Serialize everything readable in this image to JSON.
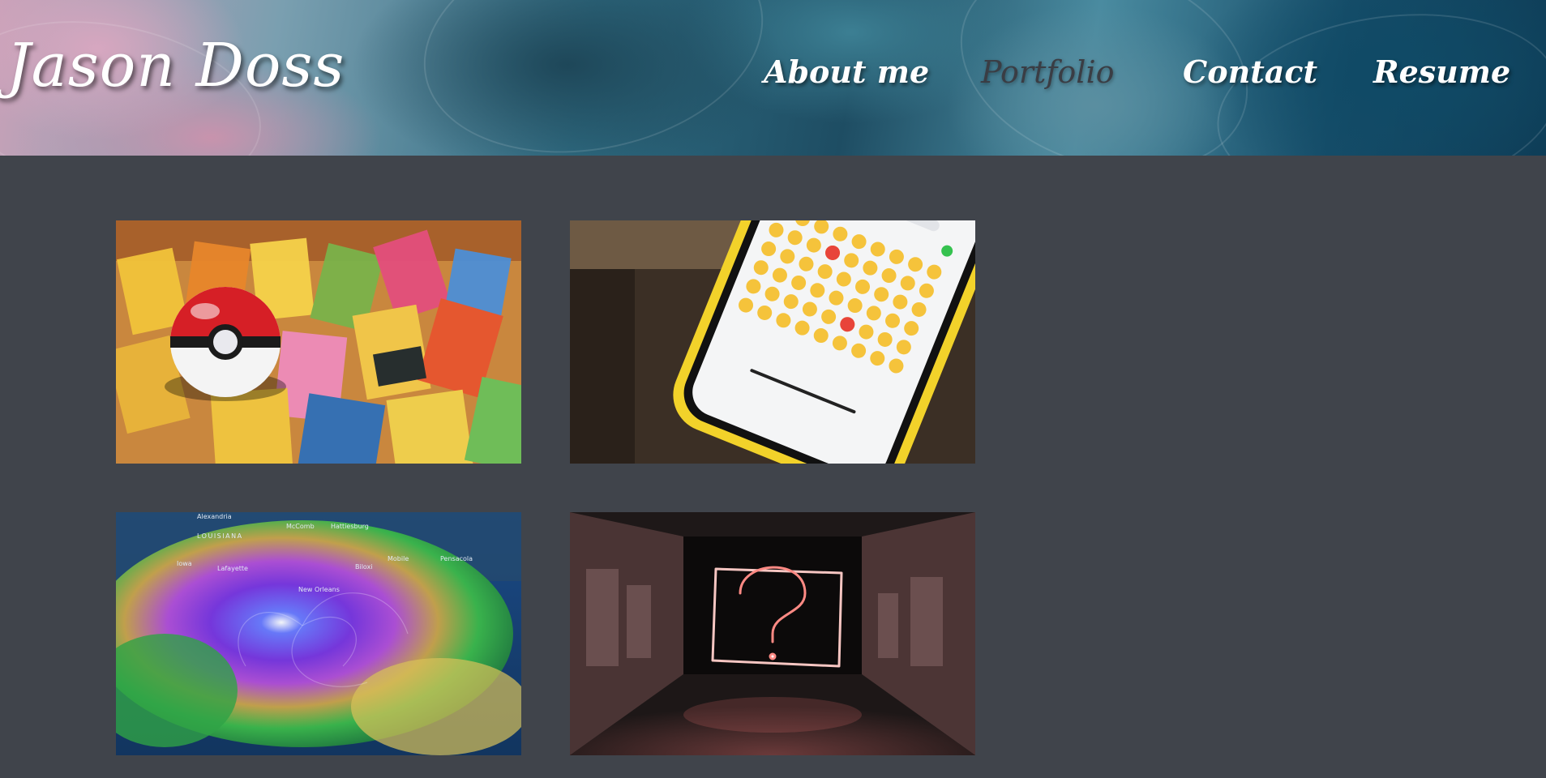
{
  "header": {
    "site_title": "Jason Doss",
    "nav": [
      {
        "label": "About me",
        "active": false
      },
      {
        "label": "Portfolio",
        "active": true
      },
      {
        "label": "Contact",
        "active": false
      },
      {
        "label": "Resume",
        "active": false
      }
    ]
  },
  "colors": {
    "page_background": "#40444b",
    "active_nav": "#3a3d44",
    "nav_text": "#ffffff"
  },
  "portfolio": {
    "items": [
      {
        "image": "pokemon-cards-pokeball",
        "caption": ""
      },
      {
        "image": "phone-emoji-keyboard",
        "caption": ""
      },
      {
        "image": "hurricane-weather-map",
        "caption": ""
      },
      {
        "image": "neon-question-mark-tunnel",
        "caption": ""
      }
    ],
    "map_labels": [
      "LOUISIANA",
      "Alexandria",
      "McComb",
      "Hattiesburg",
      "Mobile",
      "Lafayette",
      "Iowa",
      "New Orleans",
      "Biloxi",
      "Pensacola"
    ]
  }
}
